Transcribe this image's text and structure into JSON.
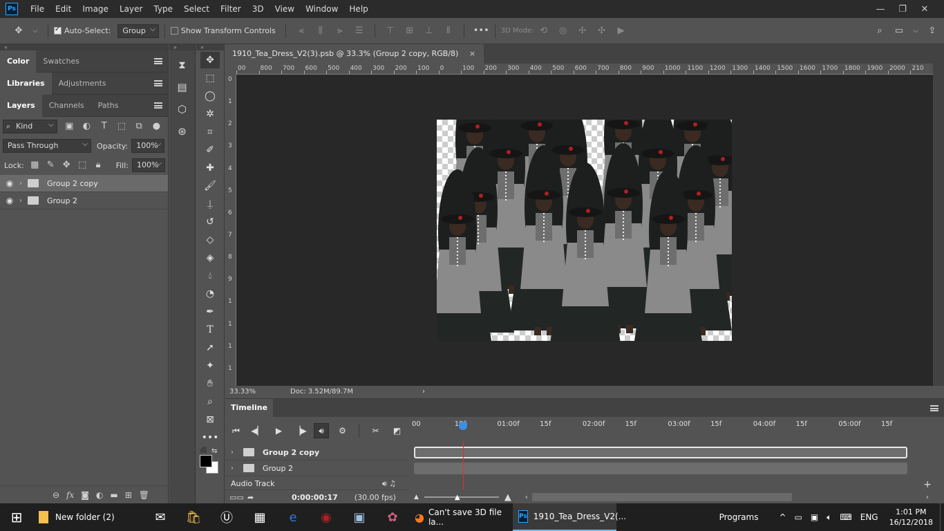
{
  "app": {
    "logo": "Ps",
    "menu": [
      "File",
      "Edit",
      "Image",
      "Layer",
      "Type",
      "Select",
      "Filter",
      "3D",
      "View",
      "Window",
      "Help"
    ],
    "window_controls": {
      "minimize": "—",
      "restore": "❐",
      "close": "✕"
    }
  },
  "options_bar": {
    "auto_select_label": "Auto-Select:",
    "auto_select_checked": true,
    "auto_select_value": "Group",
    "show_transform_label": "Show Transform Controls",
    "show_transform_checked": false,
    "mode_3d_label": "3D Mode:"
  },
  "panels": {
    "color_tabs": [
      "Color",
      "Swatches"
    ],
    "library_tabs": [
      "Libraries",
      "Adjustments"
    ],
    "layer_tabs": [
      "Layers",
      "Channels",
      "Paths"
    ],
    "filter_kind": "Kind",
    "blend_mode": "Pass Through",
    "opacity_label": "Opacity:",
    "opacity_value": "100%",
    "lock_label": "Lock:",
    "fill_label": "Fill:",
    "fill_value": "100%",
    "layers": [
      {
        "name": "Group 2 copy",
        "selected": true
      },
      {
        "name": "Group 2",
        "selected": false
      }
    ]
  },
  "document": {
    "tab_title": "1910_Tea_Dress_V2(3).psb @ 33.3% (Group 2 copy, RGB/8)",
    "close": "×",
    "ruler_h_ticks": [
      "00",
      "800",
      "700",
      "600",
      "500",
      "400",
      "300",
      "200",
      "100",
      "0",
      "100",
      "200",
      "300",
      "400",
      "500",
      "600",
      "700",
      "800",
      "900",
      "1000",
      "1100",
      "1200",
      "1300",
      "1400",
      "1500",
      "1600",
      "1700",
      "1800",
      "1900",
      "2000",
      "210"
    ],
    "ruler_v_ticks": [
      "0",
      "1",
      "2",
      "3",
      "4",
      "5",
      "6",
      "7",
      "8",
      "9",
      "1",
      "1",
      "1",
      "1"
    ],
    "zoom": "33.33%",
    "doc_info": "Doc: 3.52M/89.7M"
  },
  "timeline": {
    "title": "Timeline",
    "ruler": [
      "00",
      "15f",
      "01:00f",
      "15f",
      "02:00f",
      "15f",
      "03:00f",
      "15f",
      "04:00f",
      "15f",
      "05:00f",
      "15f"
    ],
    "tracks": [
      "Group 2 copy",
      "Group 2"
    ],
    "audio_track": "Audio Track",
    "timecode": "0:00:00:17",
    "fps": "(30.00 fps)",
    "playhead_fraction": 0.1
  },
  "taskbar": {
    "tasks": [
      {
        "label": "New folder (2)"
      },
      {
        "label": "Can't save 3D file la..."
      },
      {
        "label": "1910_Tea_Dress_V2(..."
      }
    ],
    "programs": "Programs",
    "language": "ENG",
    "time": "1:01 PM",
    "date": "16/12/2018"
  }
}
